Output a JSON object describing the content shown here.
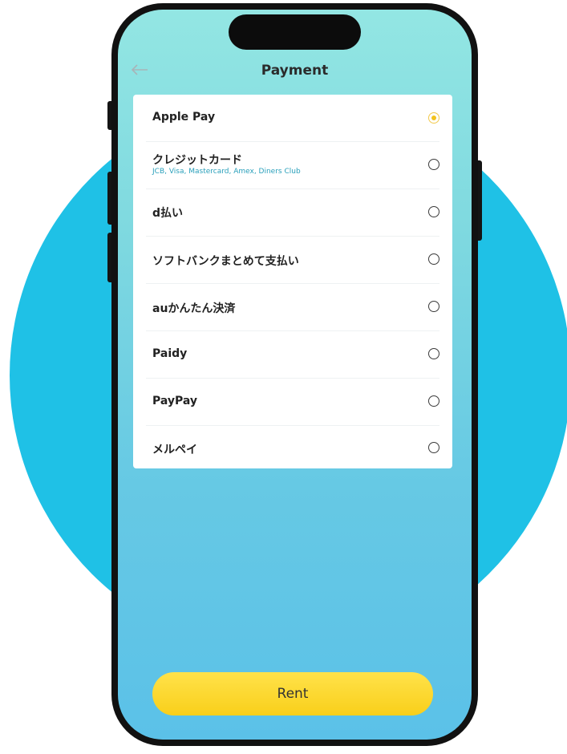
{
  "header": {
    "title": "Payment",
    "back_icon": "arrow-left-icon"
  },
  "payment_methods": [
    {
      "label": "Apple Pay",
      "sublabel": "",
      "selected": true
    },
    {
      "label": "クレジットカード",
      "sublabel": "JCB, Visa, Mastercard, Amex, Diners Club",
      "selected": false
    },
    {
      "label": "d払い",
      "sublabel": "",
      "selected": false
    },
    {
      "label": "ソフトバンクまとめて支払い",
      "sublabel": "",
      "selected": false
    },
    {
      "label": "auかんたん決済",
      "sublabel": "",
      "selected": false
    },
    {
      "label": "Paidy",
      "sublabel": "",
      "selected": false
    },
    {
      "label": "PayPay",
      "sublabel": "",
      "selected": false
    },
    {
      "label": "メルペイ",
      "sublabel": "",
      "selected": false
    }
  ],
  "footer": {
    "rent_label": "Rent"
  },
  "colors": {
    "background_circle": "#1fc1e6",
    "screen_top": "#93e6e3",
    "screen_bottom": "#5bc1e8",
    "accent_yellow": "#f9cf1a",
    "radio_selected": "#f2c21c"
  }
}
